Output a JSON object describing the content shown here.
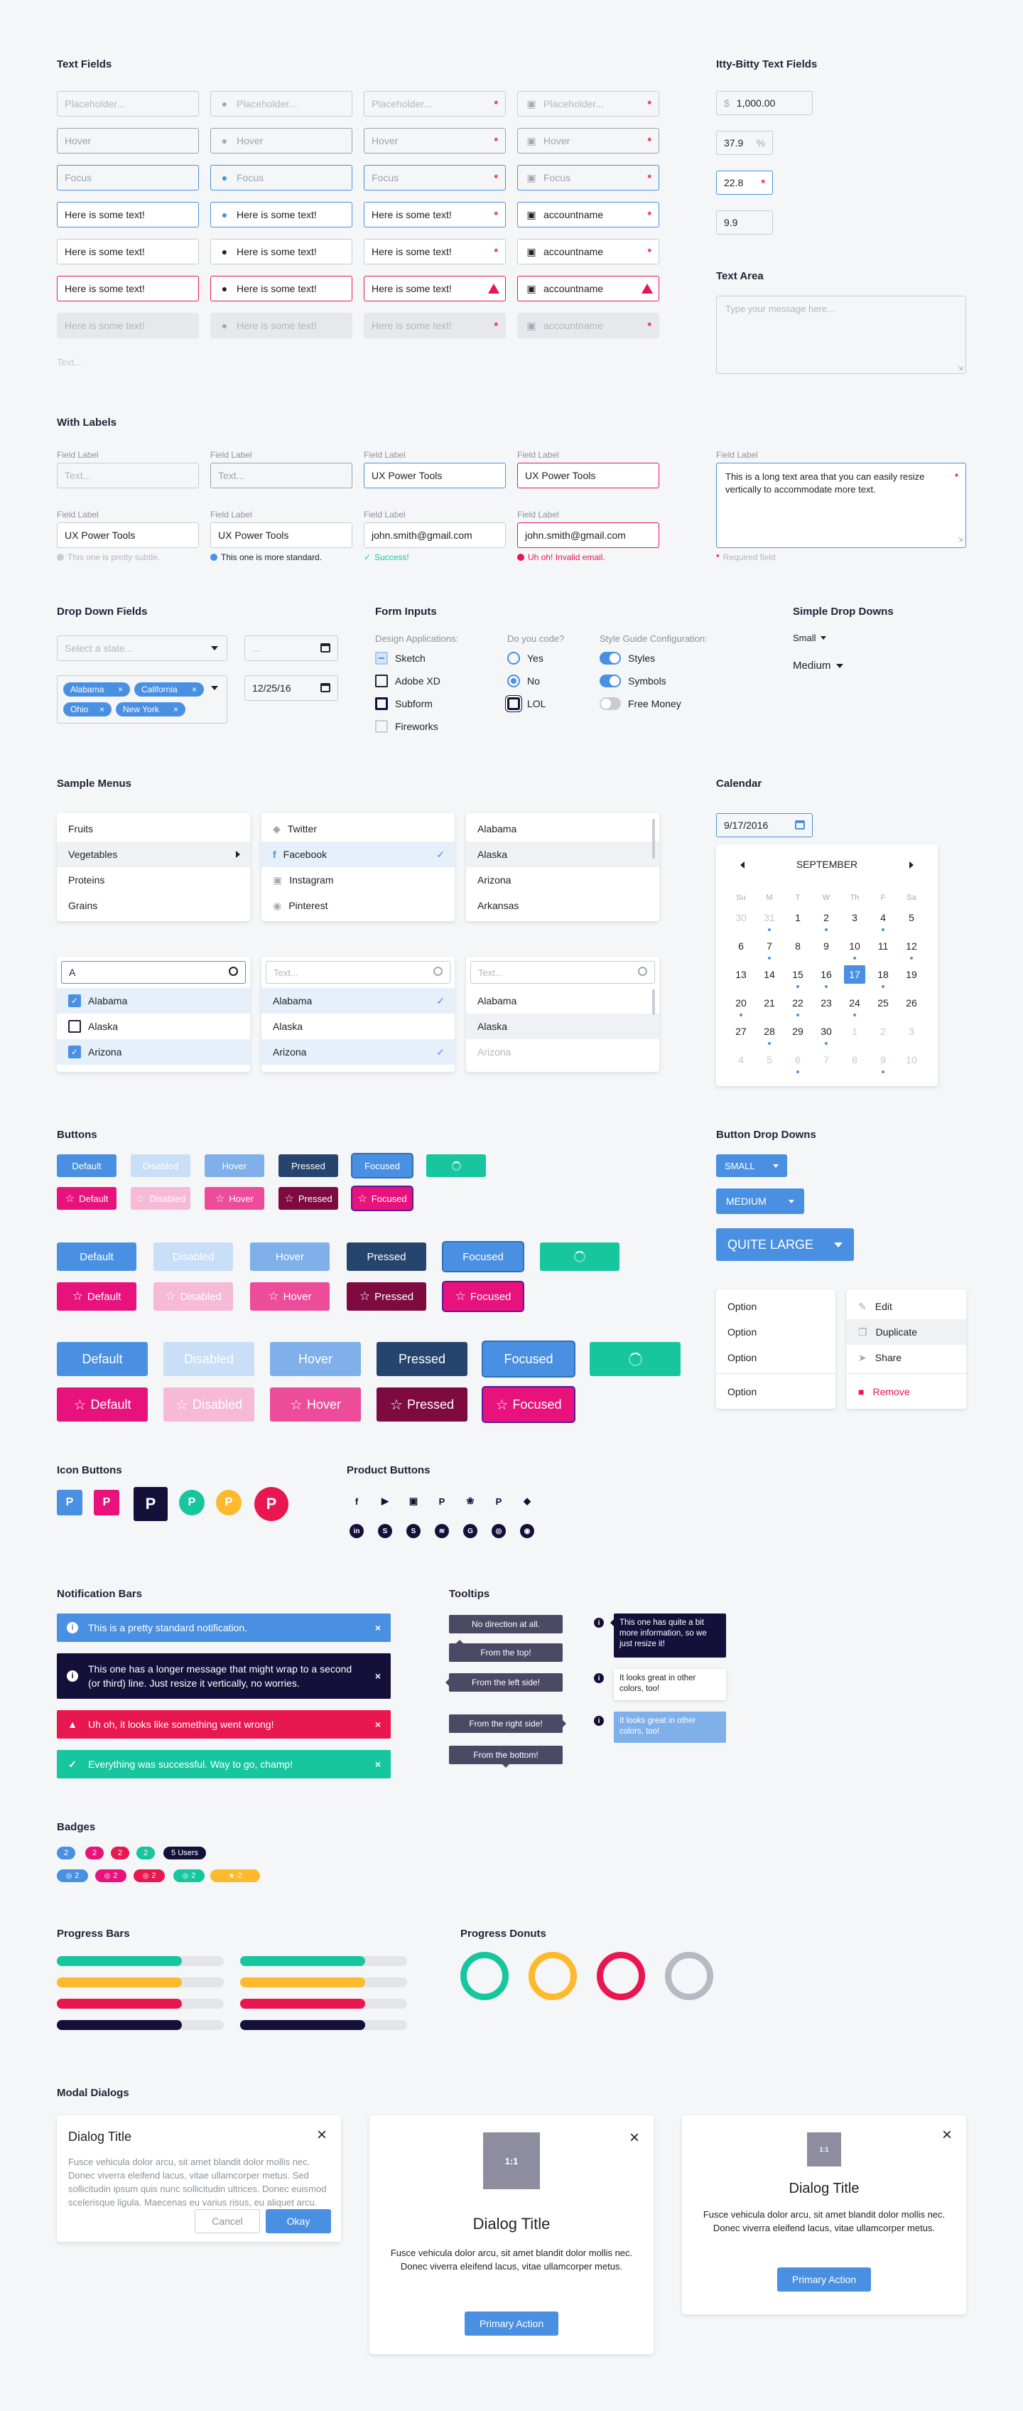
{
  "sections": {
    "text_fields": "Text Fields",
    "itty": "Itty-Bitty Text Fields",
    "text_area": "Text Area",
    "with_labels": "With Labels",
    "dropdowns": "Drop Down Fields",
    "form_inputs": "Form Inputs",
    "simple_dd": "Simple Drop Downs",
    "menus": "Sample Menus",
    "calendar": "Calendar",
    "buttons": "Buttons",
    "button_dd": "Button Drop Downs",
    "icon_buttons": "Icon Buttons",
    "product_buttons": "Product Buttons",
    "notifications": "Notification Bars",
    "tooltips": "Tooltips",
    "badges": "Badges",
    "progress_bars": "Progress Bars",
    "progress_donuts": "Progress Donuts",
    "modals": "Modal Dialogs"
  },
  "tf": {
    "placeholder": "Placeholder...",
    "hover": "Hover",
    "focus": "Focus",
    "filled": "Here is some text!",
    "account": "accountname",
    "text_only": "Text..."
  },
  "itty": {
    "currency": "$",
    "v1": "1,000.00",
    "v2": "37.9",
    "pct": "%",
    "v3": "22.8",
    "v4": "9.9"
  },
  "textarea": {
    "placeholder": "Type your message here...",
    "long": "This is a long text area that you can easily resize vertically to accommodate more text.",
    "required": "Required field"
  },
  "labels": {
    "field_label": "Field Label",
    "text_ph": "Text...",
    "ux": "UX Power Tools",
    "email": "john.smith@gmail.com",
    "hint_subtle": "This one is pretty subtle.",
    "hint_standard": "This one is more standard.",
    "hint_success": "Success!",
    "hint_error": "Uh oh! Invalid email."
  },
  "dropdowns": {
    "state_ph": "Select a state...",
    "date_ph": "...",
    "date": "12/25/16",
    "tags": [
      "Alabama",
      "California",
      "Ohio",
      "New York"
    ]
  },
  "form": {
    "design_label": "Design Applications:",
    "design": [
      "Sketch",
      "Adobe XD",
      "Subform",
      "Fireworks"
    ],
    "code_label": "Do you code?",
    "code": [
      "Yes",
      "No",
      "LOL"
    ],
    "config_label": "Style Guide Configuration:",
    "config": [
      "Styles",
      "Symbols",
      "Free Money"
    ]
  },
  "simple": {
    "small": "Small",
    "medium": "Medium"
  },
  "menus": {
    "food": [
      "Fruits",
      "Vegetables",
      "Proteins",
      "Grains"
    ],
    "social": [
      "Twitter",
      "Facebook",
      "Instagram",
      "Pinterest"
    ],
    "states": [
      "Alabama",
      "Alaska",
      "Arizona",
      "Arkansas"
    ],
    "search_value": "A",
    "search_ph": "Text...",
    "search_results": [
      "Alabama",
      "Alaska",
      "Arizona"
    ]
  },
  "calendar": {
    "input": "9/17/2016",
    "month": "SEPTEMBER",
    "dow": [
      "Su",
      "M",
      "T",
      "W",
      "Th",
      "F",
      "Sa"
    ],
    "weeks": [
      [
        "30",
        "31",
        "1",
        "2",
        "3",
        "4",
        "5"
      ],
      [
        "6",
        "7",
        "8",
        "9",
        "10",
        "11",
        "12"
      ],
      [
        "13",
        "14",
        "15",
        "16",
        "17",
        "18",
        "19"
      ],
      [
        "20",
        "21",
        "22",
        "23",
        "24",
        "25",
        "26"
      ],
      [
        "27",
        "28",
        "29",
        "30",
        "1",
        "2",
        "3"
      ],
      [
        "4",
        "5",
        "6",
        "7",
        "8",
        "9",
        "10"
      ]
    ]
  },
  "buttons": {
    "default": "Default",
    "disabled": "Disabled",
    "hover": "Hover",
    "pressed": "Pressed",
    "focused": "Focused"
  },
  "button_dd": {
    "small": "SMALL",
    "medium": "MEDIUM",
    "large": "QUITE LARGE",
    "options": [
      "Option",
      "Option",
      "Option",
      "Option"
    ],
    "actions": [
      "Edit",
      "Duplicate",
      "Share",
      "Remove"
    ]
  },
  "notifications": [
    "This is a pretty standard notification.",
    "This one has a longer message that might wrap to a second (or third) line. Just resize it vertically, no worries.",
    "Uh oh, it looks like something went wrong!",
    "Everything was successful. Way to go, champ!"
  ],
  "tooltips": {
    "none": "No direction at all.",
    "top": "From the top!",
    "left": "From the left side!",
    "right": "From the right side!",
    "bottom": "From the bottom!",
    "more": "This one has quite a bit more information, so we just resize it!",
    "other1": "It looks great in other colors, too!",
    "other2": "It looks great in other colors, too!"
  },
  "badges": {
    "n": "2",
    "users": "5 Users"
  },
  "modals": {
    "title": "Dialog Title",
    "body_long": "Fusce vehicula dolor arcu, sit amet blandit dolor mollis nec. Donec viverra eleifend lacus, vitae ullamcorper metus. Sed sollicitudin ipsum quis nunc sollicitudin ultrices. Donec euismod scelerisque ligula. Maecenas eu varius risus, eu aliquet arcu.",
    "body_short": "Fusce vehicula dolor arcu, sit amet blandit dolor mollis nec. Donec viverra eleifend lacus, vitae ullamcorper metus.",
    "cancel": "Cancel",
    "okay": "Okay",
    "primary": "Primary Action",
    "ratio": "1:1"
  },
  "progress": {
    "values": [
      0.75,
      0.75,
      0.75,
      0.75
    ],
    "donuts": [
      {
        "color": "#17c69e"
      },
      {
        "color": "#fdba2c"
      },
      {
        "color": "#e8174f"
      },
      {
        "color": "#b8bac3"
      }
    ]
  },
  "colors": {
    "blue": "#4a90e2",
    "pink": "#e8127c",
    "green": "#17c69e",
    "yellow": "#fdba2c",
    "red": "#e8174f",
    "navy": "#14103a"
  }
}
